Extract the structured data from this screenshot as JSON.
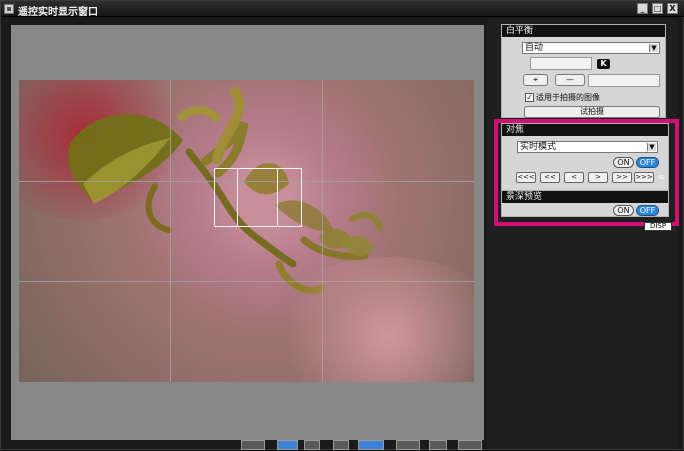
{
  "window": {
    "title": "遥控实时显示窗口",
    "controls": [
      "_",
      "□",
      "X"
    ]
  },
  "white_balance": {
    "label": "白平衡",
    "mode": "自动",
    "k_label": "K",
    "apply_label": "适用于拍摄的图像",
    "test_shot_label": "试拍摄",
    "eyedropper_icon": "eyedropper-icon"
  },
  "focus": {
    "label": "对焦",
    "mode": "实时模式",
    "on_label": "ON",
    "off_label": "OFF",
    "nav": [
      "<<<",
      "<<",
      "<",
      ">",
      ">>",
      ">>>"
    ],
    "infinity_label": "∞"
  },
  "depth_preview": {
    "label": "景深预览",
    "on_label": "ON",
    "off_label": "OFF"
  },
  "disp_label": "DISP",
  "colors": {
    "accent_blue": "#2d86d3",
    "highlight_magenta": "#d10f74",
    "panel_dark": "#111111",
    "viewer_gray": "#888888"
  }
}
